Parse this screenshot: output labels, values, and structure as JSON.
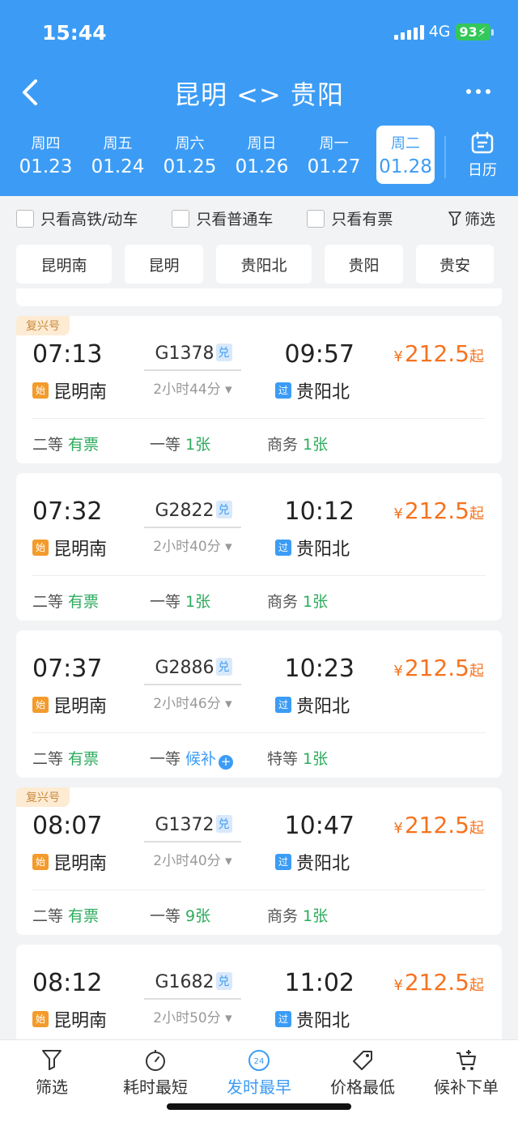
{
  "status": {
    "time": "15:44",
    "network": "4G",
    "battery": "93"
  },
  "header": {
    "title": "昆明 <> 贵阳",
    "calendar_label": "日历"
  },
  "dates": [
    {
      "weekday": "周四",
      "date": "01.23",
      "active": false
    },
    {
      "weekday": "周五",
      "date": "01.24",
      "active": false
    },
    {
      "weekday": "周六",
      "date": "01.25",
      "active": false
    },
    {
      "weekday": "周日",
      "date": "01.26",
      "active": false
    },
    {
      "weekday": "周一",
      "date": "01.27",
      "active": false
    },
    {
      "weekday": "周二",
      "date": "01.28",
      "active": true
    }
  ],
  "filters": {
    "checks": [
      "只看高铁/动车",
      "只看普通车",
      "只看有票"
    ],
    "filter_label": "筛选",
    "stations": [
      "昆明南",
      "昆明",
      "贵阳北",
      "贵阳",
      "贵安"
    ]
  },
  "trains": [
    {
      "badge": "复兴号",
      "dep_time": "07:13",
      "dep_station": "昆明南",
      "dep_tag": "始",
      "train_no": "G1378",
      "dui": "兑",
      "duration": "2小时44分",
      "arr_time": "09:57",
      "arr_station": "贵阳北",
      "arr_tag": "过",
      "price_cur": "¥",
      "price": "212.5",
      "price_suffix": "起",
      "seats": [
        {
          "cls": "二等",
          "val": "有票"
        },
        {
          "cls": "一等",
          "val": "1张"
        },
        {
          "cls": "商务",
          "val": "1张"
        }
      ]
    },
    {
      "badge": "",
      "dep_time": "07:32",
      "dep_station": "昆明南",
      "dep_tag": "始",
      "train_no": "G2822",
      "dui": "兑",
      "duration": "2小时40分",
      "arr_time": "10:12",
      "arr_station": "贵阳北",
      "arr_tag": "过",
      "price_cur": "¥",
      "price": "212.5",
      "price_suffix": "起",
      "seats": [
        {
          "cls": "二等",
          "val": "有票"
        },
        {
          "cls": "一等",
          "val": "1张"
        },
        {
          "cls": "商务",
          "val": "1张"
        }
      ]
    },
    {
      "badge": "",
      "dep_time": "07:37",
      "dep_station": "昆明南",
      "dep_tag": "始",
      "train_no": "G2886",
      "dui": "兑",
      "duration": "2小时46分",
      "arr_time": "10:23",
      "arr_station": "贵阳北",
      "arr_tag": "过",
      "price_cur": "¥",
      "price": "212.5",
      "price_suffix": "起",
      "seats": [
        {
          "cls": "二等",
          "val": "有票"
        },
        {
          "cls": "一等",
          "val": "候补"
        },
        {
          "cls": "特等",
          "val": "1张"
        }
      ]
    },
    {
      "badge": "复兴号",
      "dep_time": "08:07",
      "dep_station": "昆明南",
      "dep_tag": "始",
      "train_no": "G1372",
      "dui": "兑",
      "duration": "2小时40分",
      "arr_time": "10:47",
      "arr_station": "贵阳北",
      "arr_tag": "过",
      "price_cur": "¥",
      "price": "212.5",
      "price_suffix": "起",
      "seats": [
        {
          "cls": "二等",
          "val": "有票"
        },
        {
          "cls": "一等",
          "val": "9张"
        },
        {
          "cls": "商务",
          "val": "1张"
        }
      ]
    },
    {
      "badge": "",
      "dep_time": "08:12",
      "dep_station": "昆明南",
      "dep_tag": "始",
      "train_no": "G1682",
      "dui": "兑",
      "duration": "2小时50分",
      "arr_time": "11:02",
      "arr_station": "贵阳北",
      "arr_tag": "过",
      "price_cur": "¥",
      "price": "212.5",
      "price_suffix": "起",
      "seats": []
    }
  ],
  "tabbar": [
    {
      "label": "筛选",
      "icon": "funnel-icon",
      "active": false
    },
    {
      "label": "耗时最短",
      "icon": "stopwatch-icon",
      "active": false
    },
    {
      "label": "发时最早",
      "icon": "clock-24-icon",
      "icon_text": "24",
      "active": true
    },
    {
      "label": "价格最低",
      "icon": "price-tag-icon",
      "active": false
    },
    {
      "label": "候补下单",
      "icon": "cart-icon",
      "active": false
    }
  ],
  "colors": {
    "primary": "#3c9cf5",
    "price": "#f5731f",
    "available": "#2cab5c",
    "badge_bg": "#fdebd3"
  }
}
